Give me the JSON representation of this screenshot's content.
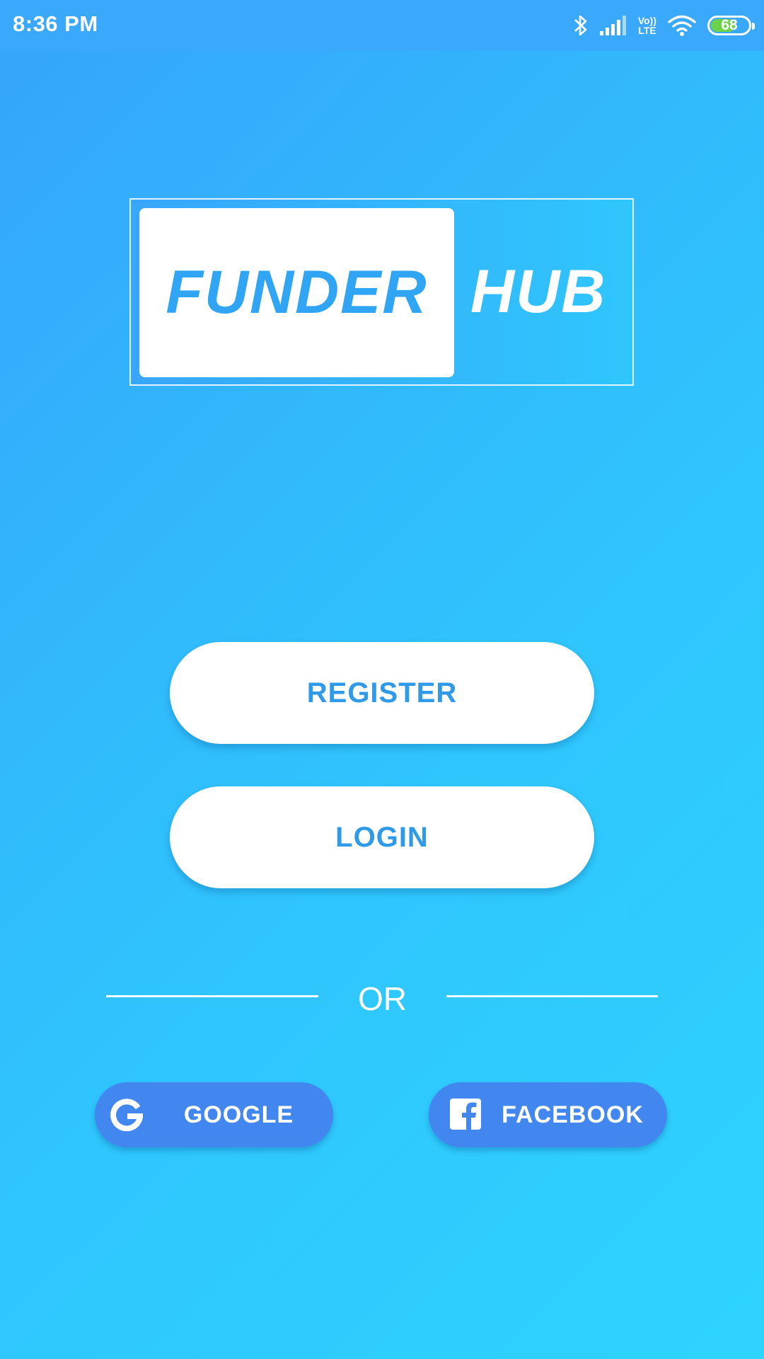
{
  "status_bar": {
    "time": "8:36 PM",
    "lte_top": "Vo))",
    "lte_bottom": "LTE",
    "battery": "68",
    "battery_level": 0.68
  },
  "logo": {
    "left_text": "FUNDER",
    "right_text": "HUB"
  },
  "buttons": {
    "register": "REGISTER",
    "login": "LOGIN"
  },
  "divider": {
    "text": "OR"
  },
  "social": {
    "google": "GOOGLE",
    "facebook": "FACEBOOK"
  },
  "colors": {
    "background_start": "#36a4fb",
    "background_end": "#2ed4fe",
    "accent_text": "#2f9ae8",
    "social_button": "#4287ef",
    "battery_fill": "#6cd24a"
  },
  "icons": {
    "bluetooth": "bluetooth-icon",
    "signal": "signal-icon",
    "wifi": "wifi-icon",
    "google": "google-icon",
    "facebook": "facebook-icon"
  }
}
